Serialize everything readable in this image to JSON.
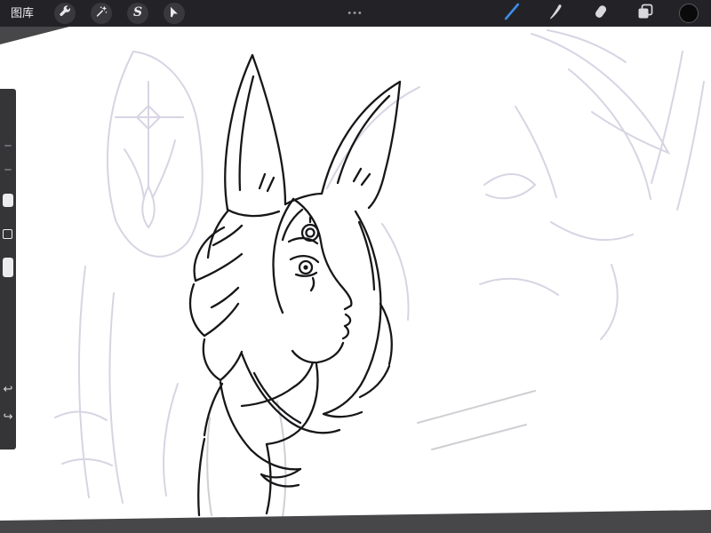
{
  "topbar": {
    "gallery_label": "图库",
    "center_handle": "•••",
    "selection_glyph": "S"
  },
  "tools": {
    "left": [
      "actions",
      "adjustments",
      "selection",
      "transform"
    ],
    "right": [
      "paint",
      "smudge",
      "erase",
      "layers",
      "color"
    ],
    "active_tool": "paint"
  },
  "sidebar": {
    "undo_glyph": "↩",
    "redo_glyph": "↪"
  },
  "colors": {
    "accent_blue": "#3f8ce8",
    "topbar_background": "#232327",
    "app_background": "#47474a",
    "canvas_background": "#ffffff",
    "ink": "#17171a",
    "sketch_lavender": "#d8d4e3",
    "current_color": "#0a0a0a"
  },
  "canvas": {
    "artwork_alt": "Line-art sketch of a character in profile facing right with two large pointed ears, a forehead gem and long rolled flowing hair; faint lavender under-sketch with a cross ornament at upper left and rough construction strokes at the right side."
  }
}
